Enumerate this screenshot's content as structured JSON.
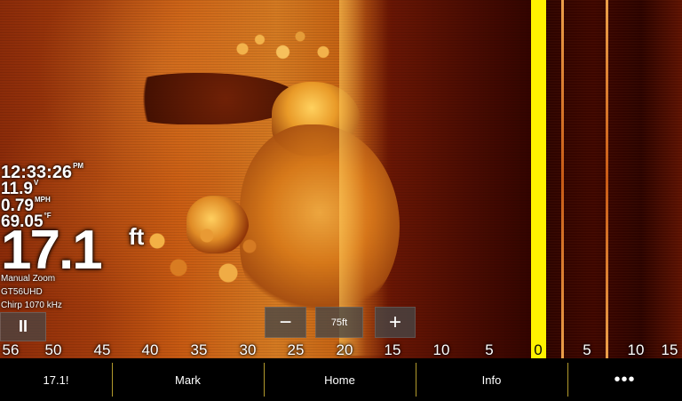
{
  "overlay": {
    "time": "12:33:26",
    "time_unit": "PM",
    "voltage": "11.9",
    "voltage_unit": "V",
    "speed": "0.79",
    "speed_unit": "MPH",
    "temperature": "69.05",
    "temperature_unit": "°F",
    "depth": "17.1",
    "depth_unit": "ft",
    "zoom_mode": "Manual Zoom",
    "model": "GT56UHD",
    "frequency": "Chirp 1070 kHz"
  },
  "controls": {
    "pause_label": "II",
    "zoom_out_label": "−",
    "zoom_value": "75ft",
    "zoom_in_label": "+"
  },
  "scale": {
    "ticks": [
      "56",
      "50",
      "45",
      "40",
      "35",
      "30",
      "25",
      "20",
      "15",
      "10",
      "5",
      "0",
      "5",
      "10",
      "15"
    ]
  },
  "bottom_bar": {
    "item1": "17.1!",
    "item2": "Mark",
    "item3": "Home",
    "item4": "Info",
    "item5": "•••"
  },
  "colors": {
    "accent_yellow": "#fff200",
    "sonar_orange": "#d47a22",
    "background": "#000000"
  }
}
